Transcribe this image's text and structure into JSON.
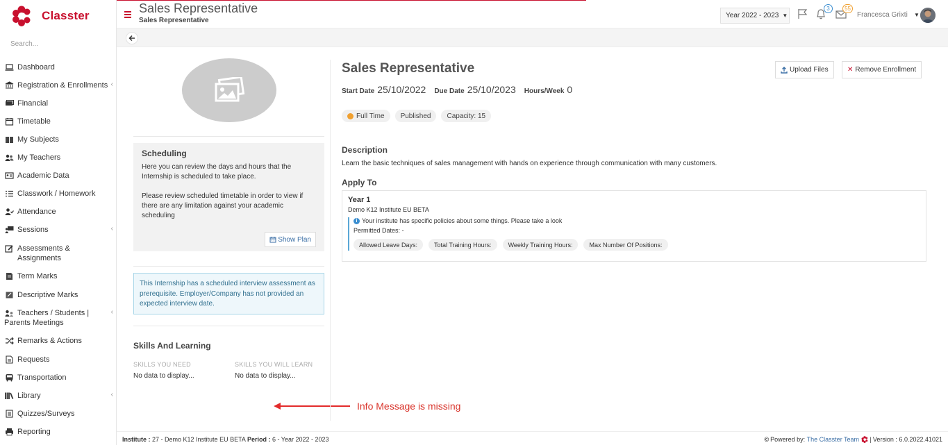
{
  "app": {
    "name": "Classter",
    "search_placeholder": "Search...",
    "brand_color": "#c8102e"
  },
  "sidebar": {
    "items": [
      {
        "label": "Dashboard",
        "icon": "laptop-icon",
        "expandable": false
      },
      {
        "label": "Registration & Enrollments",
        "icon": "institution-icon",
        "expandable": true
      },
      {
        "label": "Financial",
        "icon": "money-icon",
        "expandable": false
      },
      {
        "label": "Timetable",
        "icon": "calendar-icon",
        "expandable": false
      },
      {
        "label": "My Subjects",
        "icon": "book-icon",
        "expandable": false
      },
      {
        "label": "My Teachers",
        "icon": "users-icon",
        "expandable": false
      },
      {
        "label": "Academic Data",
        "icon": "id-card-icon",
        "expandable": false
      },
      {
        "label": "Classwork / Homework",
        "icon": "list-icon",
        "expandable": false
      },
      {
        "label": "Attendance",
        "icon": "user-check-icon",
        "expandable": false
      },
      {
        "label": "Sessions",
        "icon": "presentation-icon",
        "expandable": true
      },
      {
        "label": "Assessments & Assignments",
        "icon": "edit-icon",
        "expandable": false
      },
      {
        "label": "Term Marks",
        "icon": "file-icon",
        "expandable": false
      },
      {
        "label": "Descriptive Marks",
        "icon": "pencil-square-icon",
        "expandable": false
      },
      {
        "label": "Teachers / Students | Parents Meetings",
        "icon": "meeting-icon",
        "expandable": true
      },
      {
        "label": "Remarks & Actions",
        "icon": "shuffle-icon",
        "expandable": false
      },
      {
        "label": "Requests",
        "icon": "document-icon",
        "expandable": false
      },
      {
        "label": "Transportation",
        "icon": "bus-icon",
        "expandable": false
      },
      {
        "label": "Library",
        "icon": "books-icon",
        "expandable": true
      },
      {
        "label": "Quizzes/Surveys",
        "icon": "quiz-icon",
        "expandable": false
      },
      {
        "label": "Reporting",
        "icon": "print-icon",
        "expandable": false
      }
    ]
  },
  "header": {
    "title": "Sales Representative",
    "subtitle": "Sales Representative",
    "year_selector": "Year 2022 - 2023",
    "notifications_count": "3",
    "messages_count": "55",
    "user_name": "Francesca Grixti"
  },
  "left": {
    "scheduling_title": "Scheduling",
    "scheduling_text_1": "Here you can review the days and hours that the Internship is scheduled to take place.",
    "scheduling_text_2": "Please review scheduled timetable in order to view if there are any limitation against your academic scheduling",
    "show_plan": "Show Plan",
    "info_message": "This Internship has a scheduled interview assessment as prerequisite. Employer/Company has not provided an expected interview date.",
    "skills_title": "Skills And Learning",
    "skills_need_label": "SKILLS YOU NEED",
    "skills_learn_label": "SKILLS YOU WILL LEARN",
    "skills_need_value": "No data to display...",
    "skills_learn_value": "No data to display...",
    "annotation": "Info Message is missing"
  },
  "detail": {
    "title": "Sales Representative",
    "upload_files": "Upload Files",
    "remove_enrollment": "Remove Enrollment",
    "start_date_label": "Start Date",
    "start_date": "25/10/2022",
    "due_date_label": "Due Date",
    "due_date": "25/10/2023",
    "hours_label": "Hours/Week",
    "hours": "0",
    "pill_type": "Full Time",
    "pill_status": "Published",
    "pill_capacity": "Capacity: 15",
    "description_title": "Description",
    "description": "Learn the basic techniques of sales management with hands on experience through communication with many customers.",
    "apply_title": "Apply To",
    "apply": {
      "year": "Year 1",
      "institute": "Demo K12 Institute EU BETA",
      "policy": "Your institute has specific policies about some things. Please take a look",
      "permitted": "Permitted Dates: -",
      "tags": [
        "Allowed Leave Days:",
        "Total Training Hours:",
        "Weekly Training Hours:",
        "Max Number Of Positions:"
      ]
    }
  },
  "footer": {
    "institute_label": "Institute :",
    "institute_value": "27 - Demo K12 Institute EU BETA",
    "period_label": "Period :",
    "period_value": "6 - Year 2022 - 2023",
    "powered_by": "Powered by:",
    "team": "The Classter Team",
    "version": "| Version : 6.0.2022.41021"
  }
}
